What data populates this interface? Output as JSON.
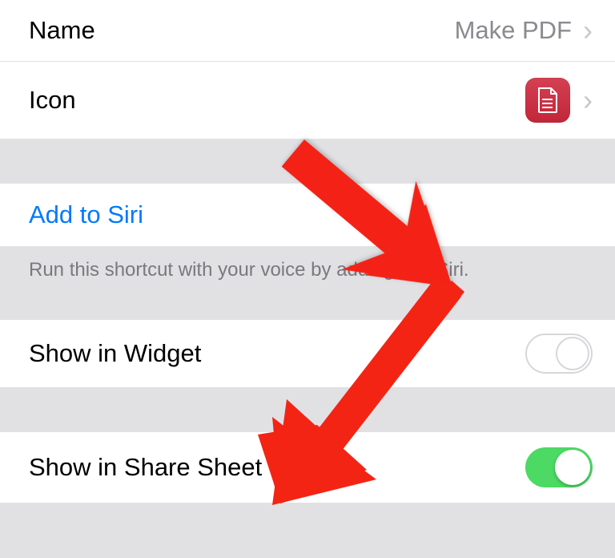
{
  "rows": {
    "name": {
      "label": "Name",
      "value": "Make PDF"
    },
    "icon": {
      "label": "Icon",
      "icon_name": "document-icon"
    },
    "siri": {
      "label": "Add to Siri"
    },
    "siri_footer": "Run this shortcut with your voice by adding it to Siri.",
    "widget": {
      "label": "Show in Widget",
      "enabled": false
    },
    "share_sheet": {
      "label": "Show in Share Sheet",
      "enabled": true
    }
  },
  "colors": {
    "accent_blue": "#0079ff",
    "toggle_green": "#4cd964",
    "app_icon": "#c92c3f",
    "annotation_red": "#f42414"
  }
}
